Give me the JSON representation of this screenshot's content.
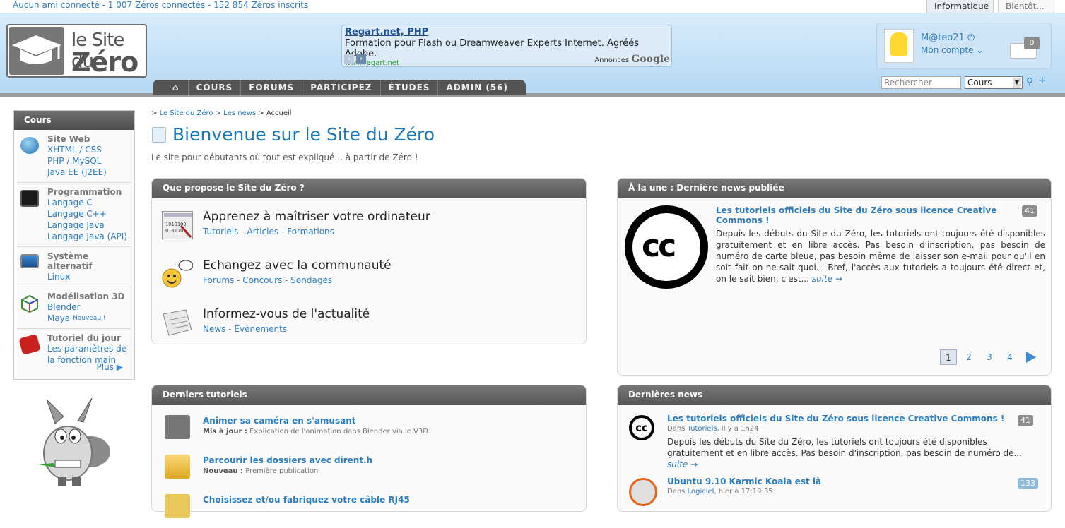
{
  "topbar": {
    "stats": "Aucun ami connecté - 1 007 Zéros connectés - 152 854 Zéros inscrits",
    "tab_active": "Informatique",
    "tab_other": "Bientôt..."
  },
  "logo": {
    "line1": "le Site du",
    "line2": "Zéro"
  },
  "ad": {
    "title": "Regart.net, PHP",
    "text": "Formation pour Flash ou Dreamweaver Experts Internet. Agréés Adobe.",
    "url": "www.regart.net",
    "badge_label": "Annonces",
    "badge_brand": "Google"
  },
  "nav": {
    "items": [
      "COURS",
      "FORUMS",
      "PARTICIPEZ",
      "ÉTUDES",
      "ADMIN (56)"
    ],
    "home_icon": "home-icon"
  },
  "user": {
    "name": "M@teo21",
    "account": "Mon compte",
    "mail_count": "0"
  },
  "search": {
    "placeholder": "Rechercher",
    "scope": "Cours",
    "plus": "+"
  },
  "sidebar": {
    "title": "Cours",
    "categories": [
      {
        "title": "Site Web",
        "links": [
          "XHTML / CSS",
          "PHP / MySQL",
          "Java EE (J2EE)"
        ],
        "icon": "globe-icon"
      },
      {
        "title": "Programmation",
        "links": [
          "Langage C",
          "Langage C++",
          "Langage Java",
          "Langage Java (API)"
        ],
        "icon": "code-icon"
      },
      {
        "title": "Système alternatif",
        "links": [
          "Linux"
        ],
        "icon": "monitor-icon"
      },
      {
        "title": "Modélisation 3D",
        "links": [
          "Blender",
          "Maya"
        ],
        "new_badge": "Nouveau !",
        "icon": "cube-icon"
      },
      {
        "title": "Tutoriel du jour",
        "links": [
          "Les paramètres de",
          "la fonction main"
        ],
        "icon": "dice-icon"
      }
    ],
    "more": "Plus"
  },
  "breadcrumb": {
    "site": "Le Site du Zéro",
    "news": "Les news",
    "current": "Accueil"
  },
  "page": {
    "title": "Bienvenue sur le Site du Zéro",
    "subtitle": "Le site pour débutants où tout est expliqué... à partir de Zéro !"
  },
  "propose": {
    "header": "Que propose le Site du Zéro ?",
    "features": [
      {
        "title": "Apprenez à maîtriser votre ordinateur",
        "links": [
          "Tutoriels",
          "Articles",
          "Formations"
        ]
      },
      {
        "title": "Echangez avec la communauté",
        "links": [
          "Forums",
          "Concours",
          "Sondages"
        ]
      },
      {
        "title": "Informez-vous de l'actualité",
        "links": [
          "News",
          "Évènements"
        ]
      }
    ]
  },
  "une": {
    "header": "À la une : Dernière news publiée",
    "title": "Les tutoriels officiels du Site du Zéro sous licence Creative Commons !",
    "count": "41",
    "text": "Depuis les débuts du Site du Zéro, les tutoriels ont toujours été disponibles gratuitement et en libre accès. Pas besoin d'inscription, pas besoin de numéro de carte bleue, pas besoin même de laisser son e-mail pour qu'il en soit fait on-ne-sait-quoi... Bref, l'accès aux tutoriels a toujours été direct et, on le sait bien, c'est...",
    "suite": "suite →",
    "logo_text": "cc",
    "pages": [
      "1",
      "2",
      "3",
      "4"
    ]
  },
  "tutorials": {
    "header": "Derniers tutoriels",
    "items": [
      {
        "title": "Animer sa caméra en s'amusant",
        "tag": "Mis à jour :",
        "note": "Explication de l'animation dans Blender via le V3D"
      },
      {
        "title": "Parcourir les dossiers avec dirent.h",
        "tag": "Nouveau :",
        "note": "Première publication"
      },
      {
        "title": "Choisissez et/ou fabriquez votre câble RJ45",
        "tag": "",
        "note": ""
      }
    ]
  },
  "news": {
    "header": "Dernières news",
    "items": [
      {
        "title": "Les tutoriels officiels du Site du Zéro sous licence Creative Commons !",
        "prefix": "Dans",
        "category": "Tutoriels",
        "time": ", il y a 1h24",
        "count": "41",
        "body": "Depuis les débuts du Site du Zéro, les tutoriels ont toujours été disponibles gratuitement et en libre accès. Pas besoin d'inscription, pas besoin de numéro de...",
        "suite": "suite →"
      },
      {
        "title": "Ubuntu 9.10 Karmic Koala est là",
        "prefix": "Dans",
        "category": "Logiciel",
        "time": ", hier à 17:19:35",
        "count": "133",
        "body": "",
        "suite": ""
      }
    ]
  }
}
